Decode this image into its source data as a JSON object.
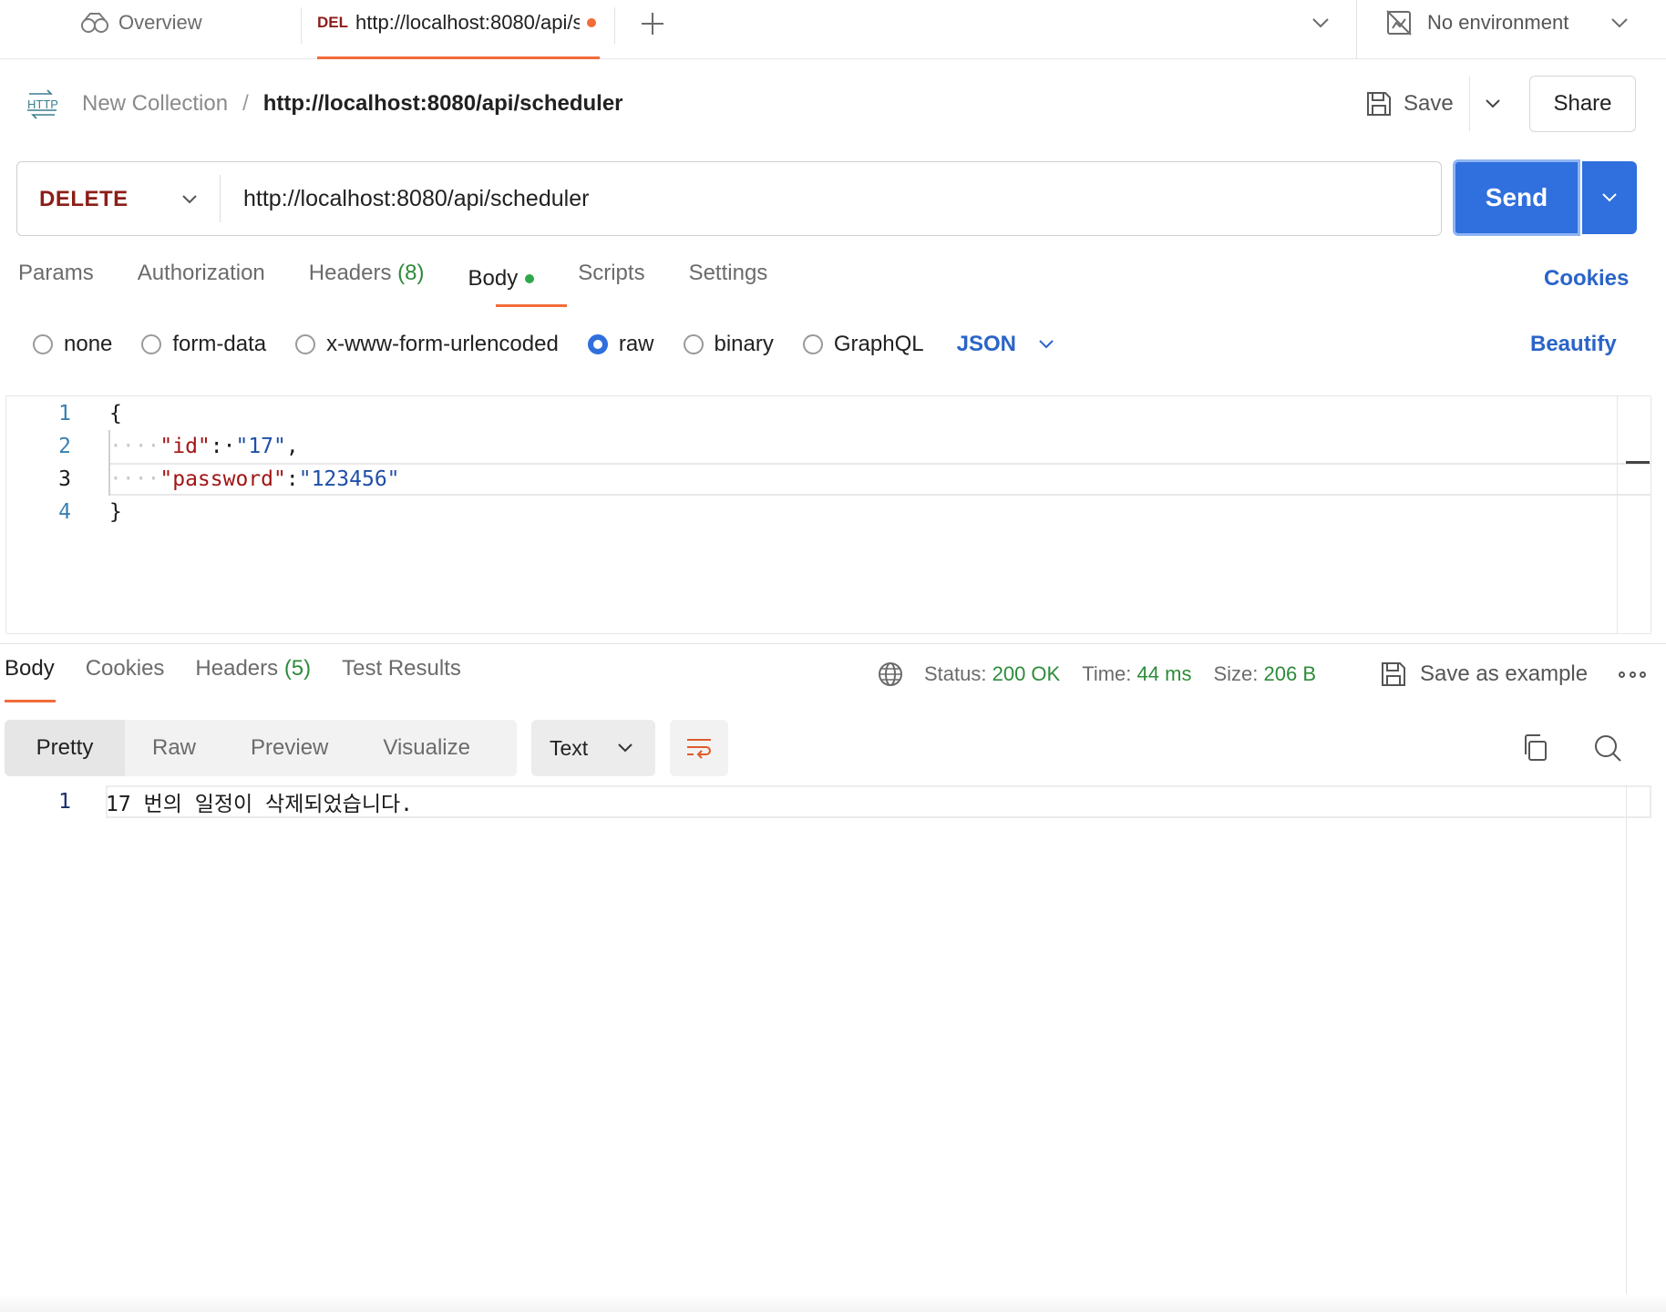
{
  "tabs": {
    "overview_label": "Overview",
    "active_method": "DEL",
    "active_url": "http://localhost:8080/api/scheduler",
    "unsaved_color": "#f26b3a"
  },
  "environment": {
    "label": "No environment"
  },
  "breadcrumb": {
    "icon_text": "HTTP",
    "collection": "New Collection",
    "separator": "/",
    "request": "http://localhost:8080/api/scheduler"
  },
  "actions": {
    "save_label": "Save",
    "share_label": "Share"
  },
  "request": {
    "method": "DELETE",
    "url": "http://localhost:8080/api/scheduler",
    "send_label": "Send",
    "method_color": "#8c1d18",
    "send_color": "#2f6fde"
  },
  "request_tabs": {
    "params": "Params",
    "authorization": "Authorization",
    "headers": "Headers",
    "headers_count": "(8)",
    "body": "Body",
    "scripts": "Scripts",
    "settings": "Settings",
    "cookies": "Cookies"
  },
  "body_types": {
    "none": "none",
    "form_data": "form-data",
    "urlencoded": "x-www-form-urlencoded",
    "raw": "raw",
    "binary": "binary",
    "graphql": "GraphQL",
    "selected": "raw",
    "format": "JSON",
    "beautify": "Beautify"
  },
  "editor": {
    "lines": [
      {
        "num": "1",
        "text": "{"
      },
      {
        "num": "2",
        "indent": "····",
        "key": "\"id\"",
        "colon": ":·",
        "value": "\"17\"",
        "tail": ","
      },
      {
        "num": "3",
        "indent": "····",
        "key": "\"password\"",
        "colon": ":",
        "value": "\"123456\"",
        "tail": ""
      },
      {
        "num": "4",
        "text": "}"
      }
    ]
  },
  "response": {
    "tabs": {
      "body": "Body",
      "cookies": "Cookies",
      "headers": "Headers",
      "headers_count": "(5)",
      "test_results": "Test Results"
    },
    "status_label": "Status:",
    "status_value": "200 OK",
    "time_label": "Time:",
    "time_value": "44 ms",
    "size_label": "Size:",
    "size_value": "206 B",
    "save_example": "Save as example",
    "views": {
      "pretty": "Pretty",
      "raw": "Raw",
      "preview": "Preview",
      "visualize": "Visualize"
    },
    "format": "Text",
    "lines": [
      {
        "num": "1",
        "text": "17 번의 일정이 삭제되었습니다."
      }
    ]
  }
}
